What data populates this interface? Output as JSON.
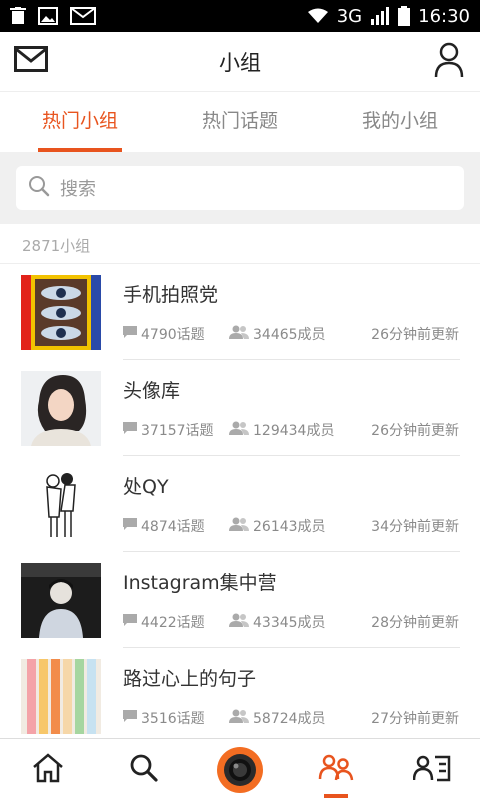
{
  "status_bar": {
    "network": "3G",
    "time": "16:30"
  },
  "header": {
    "title": "小组"
  },
  "tabs": [
    {
      "label": "热门小组",
      "active": true
    },
    {
      "label": "热门话题",
      "active": false
    },
    {
      "label": "我的小组",
      "active": false
    }
  ],
  "search": {
    "placeholder": "搜索"
  },
  "group_count": "2871小组",
  "groups": [
    {
      "name": "手机拍照党",
      "topics": "4790话题",
      "members": "34465成员",
      "updated": "26分钟前更新",
      "thumb": "colorful-eyes-art"
    },
    {
      "name": "头像库",
      "topics": "37157话题",
      "members": "129434成员",
      "updated": "26分钟前更新",
      "thumb": "portrait-girl"
    },
    {
      "name": "处QY",
      "topics": "4874话题",
      "members": "26143成员",
      "updated": "34分钟前更新",
      "thumb": "line-drawing-couple"
    },
    {
      "name": "Instagram集中营",
      "topics": "4422话题",
      "members": "43345成员",
      "updated": "28分钟前更新",
      "thumb": "night-portrait"
    },
    {
      "name": "路过心上的句子",
      "topics": "3516话题",
      "members": "58724成员",
      "updated": "27分钟前更新",
      "thumb": "colored-pencils"
    }
  ],
  "bottom_nav": [
    {
      "icon": "home-icon"
    },
    {
      "icon": "search-icon"
    },
    {
      "icon": "camera-icon"
    },
    {
      "icon": "groups-icon",
      "active": true
    },
    {
      "icon": "profile-card-icon"
    }
  ],
  "colors": {
    "accent": "#e8541e",
    "camera": "#f36d22"
  }
}
